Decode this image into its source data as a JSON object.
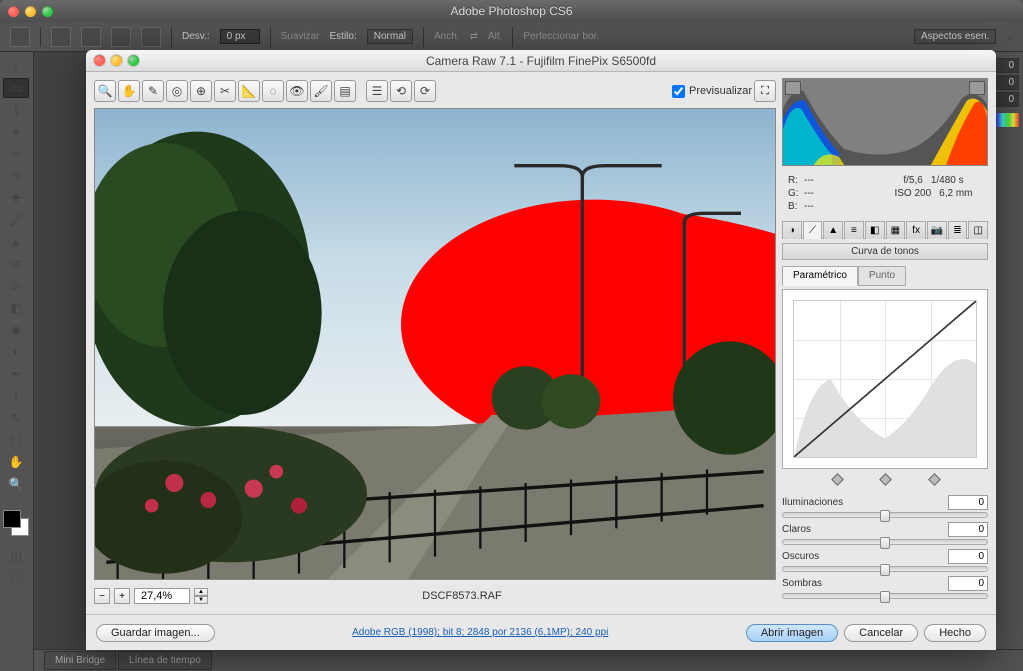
{
  "app": {
    "title": "Adobe Photoshop CS6",
    "optbar": {
      "desv_label": "Desv.:",
      "desv_value": "0 px",
      "suavizar": "Suavizar",
      "estilo_label": "Estilo:",
      "estilo_value": "Normal",
      "anch_label": "Anch.",
      "alt_label": "Alt.",
      "perfeccionar": "Perfeccionar bor.",
      "workspace": "Aspectos esen."
    },
    "status": {
      "mini_bridge": "Mini Bridge",
      "linea_tiempo": "Línea de tiempo"
    },
    "right_panel_value": "0"
  },
  "cr": {
    "title": "Camera Raw 7.1  -  Fujifilm FinePix S6500fd",
    "previsualizar": "Previsualizar",
    "zoom": "27,4%",
    "filename": "DSCF8573.RAF",
    "link": "Adobe RGB (1998); bit 8; 2848 por 2136 (6,1MP); 240 ppi",
    "buttons": {
      "guardar": "Guardar imagen...",
      "abrir": "Abrir imagen",
      "cancelar": "Cancelar",
      "hecho": "Hecho"
    },
    "info": {
      "r_label": "R:",
      "r": "---",
      "g_label": "G:",
      "g": "---",
      "b_label": "B:",
      "b": "---",
      "aperture": "f/5,6",
      "shutter": "1/480 s",
      "iso": "ISO 200",
      "focal": "6,2 mm"
    },
    "panel_title": "Curva de tonos",
    "subtabs": {
      "parametrico": "Paramétrico",
      "punto": "Punto"
    },
    "sliders": {
      "iluminaciones": {
        "label": "Iluminaciones",
        "value": "0"
      },
      "claros": {
        "label": "Claros",
        "value": "0"
      },
      "oscuros": {
        "label": "Oscuros",
        "value": "0"
      },
      "sombras": {
        "label": "Sombras",
        "value": "0"
      }
    }
  }
}
